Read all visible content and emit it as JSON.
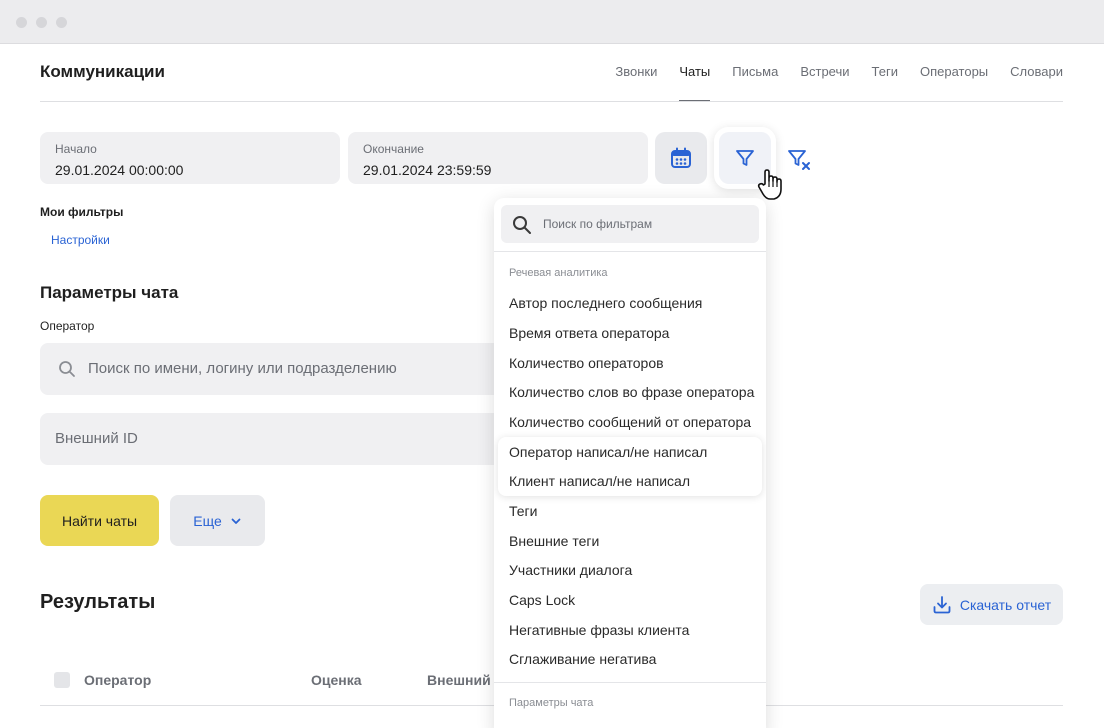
{
  "app": {
    "title": "Коммуникации"
  },
  "tabs": [
    {
      "label": "Звонки",
      "active": false
    },
    {
      "label": "Чаты",
      "active": true
    },
    {
      "label": "Письма",
      "active": false
    },
    {
      "label": "Встречи",
      "active": false
    },
    {
      "label": "Теги",
      "active": false
    },
    {
      "label": "Операторы",
      "active": false
    },
    {
      "label": "Словари",
      "active": false
    }
  ],
  "date_range": {
    "start_label": "Начало",
    "start_value": "29.01.2024 00:00:00",
    "end_label": "Окончание",
    "end_value": "29.01.2024 23:59:59"
  },
  "filters": {
    "my_filters_label": "Мои фильтры",
    "settings_link": "Настройки"
  },
  "chat_params": {
    "title": "Параметры чата",
    "operator_label": "Оператор",
    "operator_placeholder": "Поиск по имени, логину или подразделению",
    "external_id_placeholder": "Внешний ID"
  },
  "actions": {
    "find_label": "Найти чаты",
    "more_label": "Еще"
  },
  "results": {
    "title": "Результаты",
    "download_label": "Скачать отчет",
    "columns": [
      "Оператор",
      "Оценка",
      "Внешний"
    ]
  },
  "dropdown": {
    "search_placeholder": "Поиск по фильтрам",
    "group1": "Речевая аналитика",
    "items": [
      "Автор последнего сообщения",
      "Время ответа оператора",
      "Количество операторов",
      "Количество слов во фразе оператора",
      "Количество сообщений от оператора",
      "Оператор написал/не написал",
      "Клиент написал/не написал",
      "Теги",
      "Внешние теги",
      "Участники диалога",
      "Caps Lock",
      "Негативные фразы клиента",
      "Сглаживание негатива"
    ],
    "highlighted": [
      "Оператор написал/не написал",
      "Клиент написал/не написал"
    ],
    "group2": "Параметры чата"
  },
  "colors": {
    "accent": "#2a63d4",
    "primary_button": "#ead755",
    "field_bg": "#f0f0f2"
  }
}
